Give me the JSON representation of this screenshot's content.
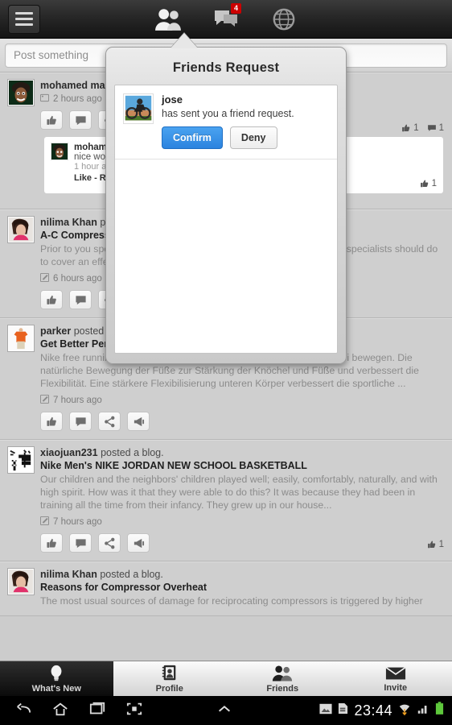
{
  "topbar": {
    "menu_icon": "hamburger-menu-icon",
    "nav": [
      {
        "name": "friends-icon",
        "icon": "two-people-icon",
        "badge": null
      },
      {
        "name": "messages-icon",
        "icon": "speech-bubbles-icon",
        "badge": "4"
      },
      {
        "name": "globe-icon",
        "icon": "globe-icon",
        "badge": null
      }
    ]
  },
  "composer": {
    "placeholder": "Post something",
    "value": ""
  },
  "dialog": {
    "title": "Friends Request",
    "request": {
      "name": "jose",
      "message": "has sent you a friend request.",
      "confirm_label": "Confirm",
      "deny_label": "Deny",
      "avatar": "motorbike-photo"
    }
  },
  "feed": {
    "posts": [
      {
        "author": "mohamed mah",
        "action": "",
        "title": "",
        "text": "",
        "time": "2 hours ago",
        "time_icon": "photo-icon",
        "actions": [
          "like-icon",
          "comment-icon",
          "share-icon"
        ],
        "likes": "1",
        "comments": "1",
        "comment": {
          "author": "mohamed",
          "text": "nice work",
          "time": "1 hour ago",
          "links": "Like - Reply",
          "likes": "1"
        }
      },
      {
        "author": "nilima Khan",
        "action": "posted a blog.",
        "title": "A-C Compressor",
        "text": "Prior to you spending a lot of money to assess the substitute financial specialists should do to cover an effective repair on any ...",
        "time": "6 hours ago",
        "time_icon": "blog-icon",
        "actions": [
          "like-icon",
          "comment-icon",
          "share-icon",
          "promote-icon"
        ],
        "likes": "",
        "comments": ""
      },
      {
        "author": "parker",
        "action": "posted a blog.",
        "title": "Get Better Performance mit Nike Free Laufschuhe",
        "text": "Nike free running Schuhe wurden entwickelt, um die Füße zu mehr frei bewegen. Die natürliche Bewegung der Füße zur Stärkung der Knöchel und Füße und verbessert die Flexibilität. Eine stärkere Flexibilisierung unteren Körper verbessert die sportliche ...",
        "time": "7 hours ago",
        "time_icon": "blog-icon",
        "actions": [
          "like-icon",
          "comment-icon",
          "share-icon",
          "promote-icon"
        ],
        "likes": "",
        "comments": ""
      },
      {
        "author": "xiaojuan231",
        "action": "posted a blog.",
        "title": "Nike Men's NIKE JORDAN NEW SCHOOL BASKETBALL",
        "text": "Our children and the neighbors' children played well; easily, comfortably, naturally, and with high spirit. How was it that they were able to do this? It was because they had been in training all the time from their infancy. They grew up in our house...",
        "time": "7 hours ago",
        "time_icon": "blog-icon",
        "actions": [
          "like-icon",
          "comment-icon",
          "share-icon",
          "promote-icon"
        ],
        "likes": "1",
        "comments": ""
      },
      {
        "author": "nilima Khan",
        "action": "posted a blog.",
        "title": "Reasons for Compressor Overheat",
        "text": "The most usual sources of damage for reciprocating compressors is triggered by higher",
        "time": "",
        "time_icon": "",
        "actions": [],
        "likes": "",
        "comments": ""
      }
    ]
  },
  "tabbar": {
    "tabs": [
      {
        "label": "What's New",
        "icon": "lightbulb-icon",
        "active": true
      },
      {
        "label": "Profile",
        "icon": "contact-card-icon",
        "active": false
      },
      {
        "label": "Friends",
        "icon": "two-people-icon",
        "active": false
      },
      {
        "label": "Invite",
        "icon": "envelope-icon",
        "active": false
      }
    ]
  },
  "sysbar": {
    "buttons": [
      "back-icon",
      "home-icon",
      "recents-icon",
      "screenshot-icon",
      "expand-up-icon"
    ],
    "status_icons": [
      "image-icon",
      "sd-card-icon",
      "wifi-icon",
      "signal-icon",
      "battery-icon"
    ],
    "clock": "23:44"
  },
  "colors": {
    "accent": "#2b83df",
    "badge": "#cc0000",
    "bg": "#cccccc"
  }
}
